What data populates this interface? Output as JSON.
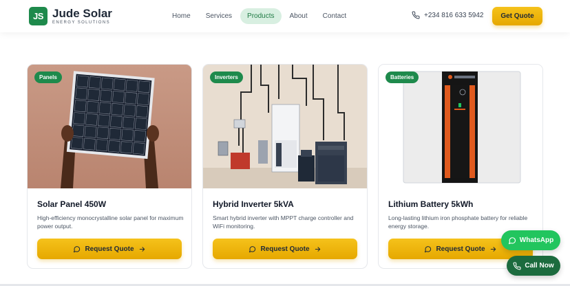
{
  "header": {
    "logo_mark": "JS",
    "brand_name": "Jude Solar",
    "brand_tagline": "ENERGY SOLUTIONS",
    "nav": [
      {
        "label": "Home",
        "active": false
      },
      {
        "label": "Services",
        "active": false
      },
      {
        "label": "Products",
        "active": true
      },
      {
        "label": "About",
        "active": false
      },
      {
        "label": "Contact",
        "active": false
      }
    ],
    "phone": "+234 816 633 5942",
    "cta_label": "Get Quote"
  },
  "products": [
    {
      "badge": "Panels",
      "title": "Solar Panel 450W",
      "description": "High-efficiency monocrystalline solar panel for maximum power output.",
      "button_label": "Request Quote"
    },
    {
      "badge": "Inverters",
      "title": "Hybrid Inverter 5kVA",
      "description": "Smart hybrid inverter with MPPT charge controller and WiFi monitoring.",
      "button_label": "Request Quote"
    },
    {
      "badge": "Batteries",
      "title": "Lithium Battery 5kWh",
      "description": "Long-lasting lithium iron phosphate battery for reliable energy storage.",
      "button_label": "Request Quote"
    }
  ],
  "floating": {
    "whatsapp_label": "WhatsApp",
    "call_label": "Call Now"
  },
  "colors": {
    "brand_green": "#1e8a4c",
    "accent_yellow": "#f5c21b",
    "whatsapp_green": "#22c55e",
    "call_green": "#1c6b3e"
  },
  "icons": {
    "phone": "phone-icon",
    "chat": "chat-bubble-icon",
    "arrow": "arrow-right-icon",
    "whatsapp": "whatsapp-icon"
  }
}
